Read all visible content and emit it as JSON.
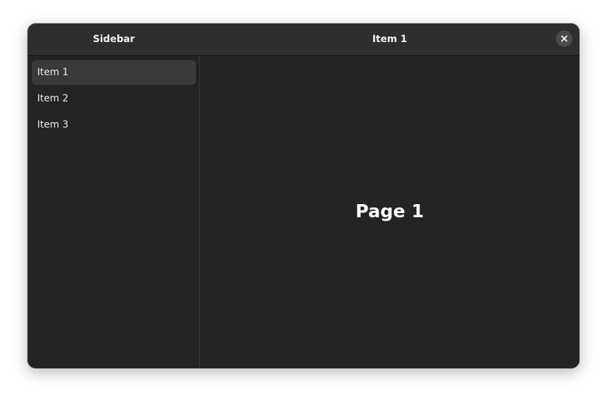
{
  "sidebar": {
    "title": "Sidebar",
    "items": [
      {
        "label": "Item 1",
        "selected": true
      },
      {
        "label": "Item 2",
        "selected": false
      },
      {
        "label": "Item 3",
        "selected": false
      }
    ]
  },
  "content": {
    "title": "Item 1",
    "page_title": "Page 1"
  },
  "icons": {
    "close": "close-icon"
  }
}
